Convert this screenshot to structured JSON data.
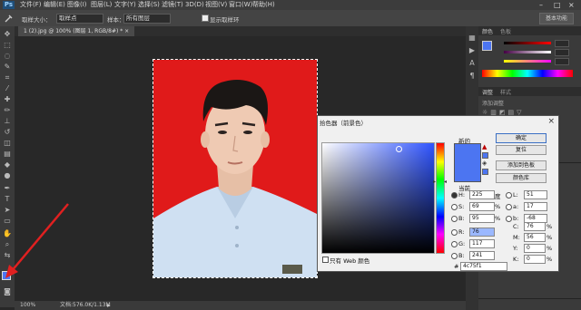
{
  "app": {
    "logo": "Ps"
  },
  "menu": [
    "文件(F)",
    "编辑(E)",
    "图像(I)",
    "图层(L)",
    "文字(Y)",
    "选择(S)",
    "滤镜(T)",
    "3D(D)",
    "视图(V)",
    "窗口(W)",
    "帮助(H)"
  ],
  "window_controls": {
    "minimize": "–",
    "maximize": "□",
    "close": "×"
  },
  "options": {
    "sample_size_label": "取样大小：",
    "sample_size_value": "取样点",
    "sample_label": "样本：",
    "sample_value": "所有图层",
    "show_ring_label": "显示取样环",
    "workspace": "基本功能"
  },
  "document_tab": "1 (2).jpg @ 100% (图层 1, RGB/8#) * ×",
  "statusbar": {
    "zoom": "100%",
    "doc_info": "文档:576.0K/1.13M"
  },
  "right_panel": {
    "tab_color": "颜色",
    "tab_swatches": "色板",
    "tab_adjust": "调整",
    "tab_styles": "样式",
    "add_adjust": "添加调整"
  },
  "picker": {
    "title": "拾色器（前景色）",
    "close": "×",
    "label_new": "新的",
    "label_current": "当前",
    "ok": "确定",
    "reset": "复位",
    "add_swatch": "添加到色板",
    "libraries": "颜色库",
    "web_only": "只有 Web 颜色",
    "fields": {
      "H": "225",
      "S": "69",
      "B": "95",
      "R": "76",
      "G": "117",
      "Bl": "241",
      "L": "51",
      "a": "17",
      "b": "-68",
      "C": "76",
      "M": "56",
      "Y": "0",
      "K": "0"
    },
    "units": {
      "H": "度",
      "S": "%",
      "B": "%",
      "C": "%",
      "M": "%",
      "Y": "%",
      "K": "%"
    },
    "hex": "4c75f1",
    "new_color": "#4c75f1",
    "current_color": "#4c75f1"
  }
}
